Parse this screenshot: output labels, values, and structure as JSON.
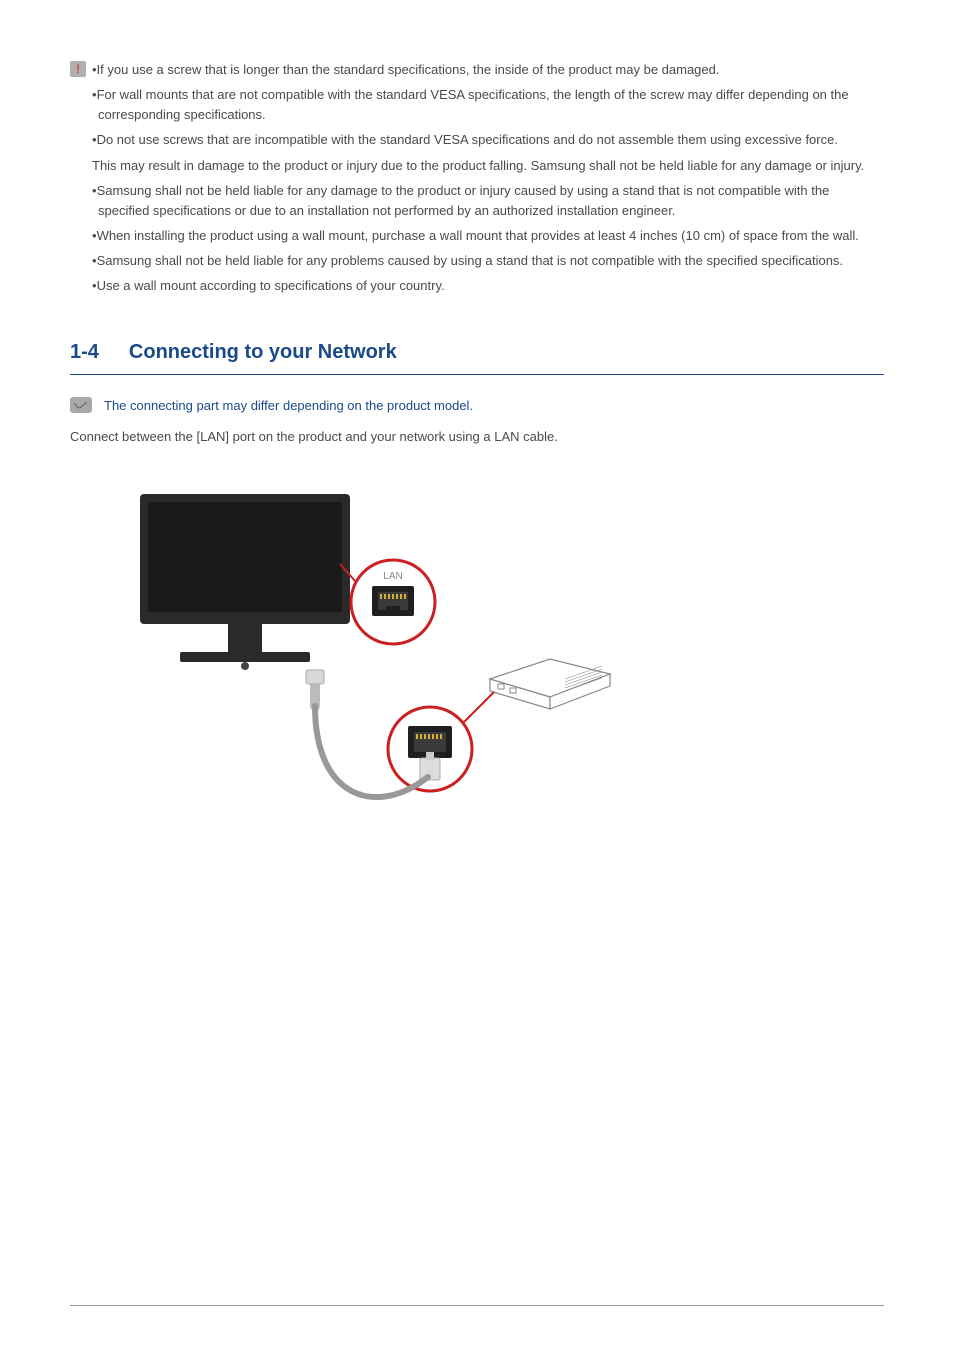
{
  "warning_block": {
    "bullets": [
      "If you use a screw that is longer than the standard specifications, the inside of the product may be damaged.",
      "For wall mounts that are not compatible with the standard VESA specifications, the length of the screw may differ depending on the corresponding specifications.",
      "Do not use screws that are incompatible with the standard VESA specifications and do not assemble them using excessive force."
    ],
    "plain": "This may result in damage to the product or injury due to the product falling. Samsung shall not be held liable for any damage or injury.",
    "bullets2": [
      "Samsung shall not be held liable for any damage to the product or injury caused by using a stand that is not compatible with the specified specifications or due to an installation not performed by an authorized installation engineer.",
      "When installing the product using a wall mount, purchase a wall mount that provides at least 4 inches (10 cm)  of space from the wall.",
      "Samsung shall not be held liable for any problems caused by using a stand that is not compatible with the specified specifications.",
      "Use a wall mount according to specifications of your country."
    ]
  },
  "section": {
    "number": "1-4",
    "title": "Connecting to your Network"
  },
  "note": {
    "text": "The connecting part may differ depending on the product model."
  },
  "body": {
    "text": "Connect between the [LAN] port on the product and your network using a LAN cable."
  },
  "illustration": {
    "lan_label": "LAN"
  }
}
